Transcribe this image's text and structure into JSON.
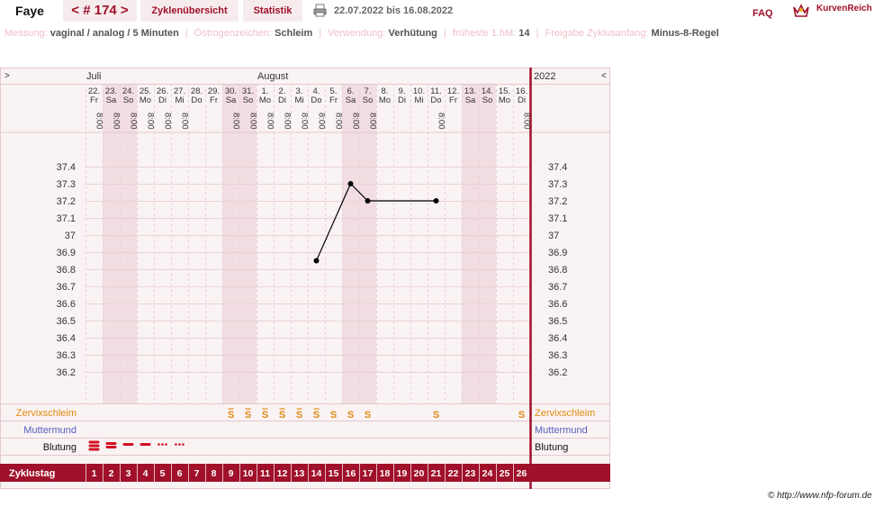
{
  "header": {
    "user_name": "Faye",
    "cycle_nav": "< # 174 >",
    "overview_tab": "Zyklenübersicht",
    "stats_tab": "Statistik",
    "date_range": "22.07.2022 bis 16.08.2022",
    "faq": "FAQ",
    "logo_text": "KurvenReich"
  },
  "info": {
    "messung_label": "Messung:",
    "messung_value": "vaginal / analog / 5 Minuten",
    "oestrogen_label": "Östrogenzeichen:",
    "oestrogen_value": "Schleim",
    "verwendung_label": "Verwendung:",
    "verwendung_value": "Verhütung",
    "hm_label": "früheste 1.hM:",
    "hm_value": "14",
    "freigabe_label": "Freigabe Zyklusanfang:",
    "freigabe_value": "Minus-8-Regel"
  },
  "chart_data": {
    "type": "line",
    "title": "",
    "xlabel": "Zyklustag",
    "ylabel": "",
    "ylim": [
      36.2,
      37.4
    ],
    "yticks": [
      "37.4",
      "37.3",
      "37.2",
      "37.1",
      "37",
      "36.9",
      "36.8",
      "36.7",
      "36.6",
      "36.5",
      "36.4",
      "36.3",
      "36.2"
    ],
    "year": "2022",
    "nav_left": ">",
    "nav_right": "<",
    "months": [
      {
        "label": "Juli",
        "day_index": 0
      },
      {
        "label": "August",
        "day_index": 10
      }
    ],
    "days": [
      {
        "date": "22.",
        "wd": "Fr",
        "time": "8:00",
        "we": false
      },
      {
        "date": "23.",
        "wd": "Sa",
        "time": "8:00",
        "we": true
      },
      {
        "date": "24.",
        "wd": "So",
        "time": "8:00",
        "we": true
      },
      {
        "date": "25.",
        "wd": "Mo",
        "time": "8:00",
        "we": false
      },
      {
        "date": "26.",
        "wd": "Di",
        "time": "8:00",
        "we": false
      },
      {
        "date": "27.",
        "wd": "Mi",
        "time": "8:00",
        "we": false
      },
      {
        "date": "28.",
        "wd": "Do",
        "time": "",
        "we": false
      },
      {
        "date": "29.",
        "wd": "Fr",
        "time": "",
        "we": false
      },
      {
        "date": "30.",
        "wd": "Sa",
        "time": "8:00",
        "we": true
      },
      {
        "date": "31.",
        "wd": "So",
        "time": "8:00",
        "we": true
      },
      {
        "date": "1.",
        "wd": "Mo",
        "time": "8:00",
        "we": false
      },
      {
        "date": "2.",
        "wd": "Di",
        "time": "8:00",
        "we": false
      },
      {
        "date": "3.",
        "wd": "Mi",
        "time": "8:00",
        "we": false
      },
      {
        "date": "4.",
        "wd": "Do",
        "time": "8:00",
        "we": false
      },
      {
        "date": "5.",
        "wd": "Fr",
        "time": "8:00",
        "we": false
      },
      {
        "date": "6.",
        "wd": "Sa",
        "time": "8:00",
        "we": true
      },
      {
        "date": "7.",
        "wd": "So",
        "time": "8:00",
        "we": true
      },
      {
        "date": "8.",
        "wd": "Mo",
        "time": "",
        "we": false
      },
      {
        "date": "9.",
        "wd": "Di",
        "time": "",
        "we": false
      },
      {
        "date": "10.",
        "wd": "Mi",
        "time": "",
        "we": false
      },
      {
        "date": "11.",
        "wd": "Do",
        "time": "8:00",
        "we": false
      },
      {
        "date": "12.",
        "wd": "Fr",
        "time": "",
        "we": false
      },
      {
        "date": "13.",
        "wd": "Sa",
        "time": "",
        "we": true
      },
      {
        "date": "14.",
        "wd": "So",
        "time": "",
        "we": true
      },
      {
        "date": "15.",
        "wd": "Mo",
        "time": "",
        "we": false
      },
      {
        "date": "16.",
        "wd": "Di",
        "time": "8:00",
        "we": false
      }
    ],
    "cycle_days": [
      1,
      2,
      3,
      4,
      5,
      6,
      7,
      8,
      9,
      10,
      11,
      12,
      13,
      14,
      15,
      16,
      17,
      18,
      19,
      20,
      21,
      22,
      23,
      24,
      25,
      26
    ],
    "series": [
      {
        "points": [
          [
            14,
            36.85
          ],
          [
            16,
            37.3
          ],
          [
            17,
            37.2
          ],
          [
            21,
            37.2
          ]
        ]
      }
    ],
    "rows": {
      "zervix_label": "Zervixschleim",
      "zervix_symbol": "S",
      "zervix_days": [
        9,
        10,
        11,
        12,
        13,
        14,
        15,
        16,
        17,
        21,
        26
      ],
      "zervix_marked_days": [
        9,
        10,
        11,
        12,
        13,
        14
      ],
      "muttermund_label": "Muttermund",
      "blutung_label": "Blutung",
      "blutung": [
        {
          "day": 1,
          "level": 4
        },
        {
          "day": 2,
          "level": 3
        },
        {
          "day": 3,
          "level": 2
        },
        {
          "day": 4,
          "level": 2
        },
        {
          "day": 5,
          "level": 1
        },
        {
          "day": 6,
          "level": 1
        }
      ]
    },
    "zyklustag_label": "Zyklustag",
    "colors": {
      "accent": "#a0102a",
      "cervix": "#e08a10",
      "muttermund": "#5560c0",
      "weekend": "#f2dde2",
      "bg": "#faf3f4",
      "line": "#000000"
    }
  },
  "footer": {
    "copyright": "© http://www.nfp-forum.de"
  }
}
